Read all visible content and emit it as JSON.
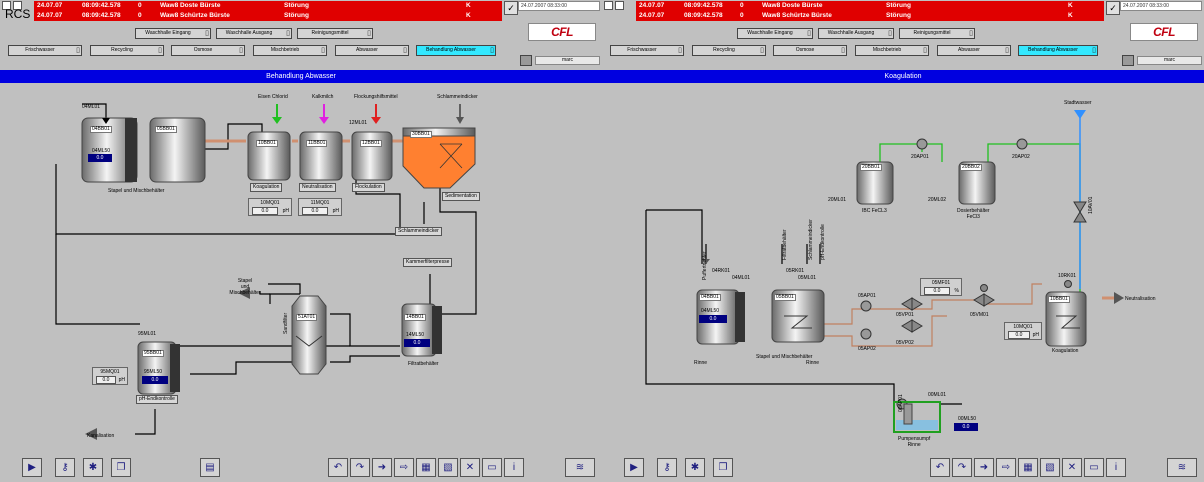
{
  "app": {
    "rcs": "RCS",
    "user": "marc",
    "logo": "CFL",
    "timestamp": "24.07.2007 08:33:00"
  },
  "alarms": [
    {
      "date": "24.07.07",
      "time": "08:09:42.578",
      "code": "0",
      "text": "Waw8 Doste Bürste",
      "status": "Störung",
      "cls": "K"
    },
    {
      "date": "24.07.07",
      "time": "08:09:42.578",
      "code": "0",
      "text": "Waw8 Schürtze Bürste",
      "status": "Störung",
      "cls": "K"
    }
  ],
  "nav": {
    "row1": [
      "Waschhalle Eingang",
      "Waschhalle Ausgang",
      "Reinigungsmittel"
    ],
    "row2": [
      "Frischwasser",
      "Recycling",
      "Osmose",
      "Mischbetrieb",
      "Abwasser",
      "Behandlung Abwasser"
    ]
  },
  "left": {
    "title": "Behandlung Abwasser",
    "labels": {
      "top_pipe": "04ML01",
      "tank1": "04BB01",
      "tank1_level": "04ML50",
      "tank1_val": "0.0",
      "tank2": "05BB01",
      "stapel": "Stapel und Mischbehälter",
      "eisenchlorid": "Eisen Chlorid",
      "kalkmilch": "Kalkmilch",
      "flockung": "Flockungshilfsmittel",
      "schlamm_top": "Schlammeindicker",
      "t10": "10BB01",
      "t11": "11BB01",
      "t12": "12BB01",
      "t12m": "12ML01",
      "t30": "30BB01",
      "koag": "Koagulation",
      "neutr": "Neutralisation",
      "flock": "Flockulation",
      "sedi": "Sedimentation",
      "m10": "10MQ01",
      "m10v": "0.0",
      "m10u": "pH",
      "m11": "11MQ01",
      "m11v": "0.0",
      "m11u": "pH",
      "schlamm_box": "Schlammeindicker",
      "kammer": "Kammerfilterpresse",
      "stapel_back": "Stapel\nund\nMischbehälter",
      "sand": "51AT01",
      "sandfilter": "Sandfilter",
      "t14": "14BB01",
      "t14l": "14ML50",
      "t14v": "0.0",
      "filtrat": "Filtratbehälter",
      "t95m": "95ML01",
      "t95": "95BB01",
      "t95l": "95ML50",
      "t95v": "0.0",
      "m95": "95MQ01",
      "m95v": "0.0",
      "m95u": "pH",
      "endk": "pH-Endkontrolle",
      "kanal": "Kanalisation"
    }
  },
  "right": {
    "title": "Koagulation",
    "labels": {
      "stadt": "Stadtwasser",
      "t20a": "20BB01",
      "t20b": "20BB02",
      "p20a": "20AP01",
      "p20b": "20AP02",
      "m20a": "20ML01",
      "m20b": "20ML02",
      "ibc": "IBC FeCL3",
      "dos": "Dosierbehälter\nFeCl3",
      "v10": "10AV01",
      "puff": "Puffertrichter",
      "r04": "04RK01",
      "m04": "04ML01",
      "t04": "04BB01",
      "l04": "04ML50",
      "v04": "0.0",
      "filt": "Filtratbehälter",
      "schl": "Schlammeindicker",
      "endk": "pH-Endkontrolle",
      "r05": "05RK01",
      "m05": "05ML01",
      "t05": "05BB01",
      "p05a": "05AP01",
      "p05b": "05AP02",
      "v05a": "05VP01",
      "v05b": "05VP02",
      "vm05": "05VM01",
      "f05": "05MF01",
      "f05v": "0.0",
      "f05u": "%",
      "r10": "10RK01",
      "t10": "10BB01",
      "m10": "10MQ01",
      "m10v": "0.0",
      "m10u": "pH",
      "koag": "Koagulation",
      "neutr": "Neutralisation",
      "stapel": "Stapel und Mischbehälter",
      "rinne1": "Rinne",
      "rinne2": "Rinne",
      "p00": "00AP01",
      "m00": "00ML01",
      "l00": "00ML50",
      "l00v": "0.0",
      "pump": "Pumpensumpf\nRinne"
    }
  },
  "colors": {
    "alarm": "#e00000",
    "title": "#0000e0",
    "active": "#33e8ff",
    "green": "#20c020",
    "magenta": "#e020e0",
    "red": "#e02020",
    "blue": "#3090ff",
    "orange": "#ff8030",
    "pipe": "#c08060"
  }
}
